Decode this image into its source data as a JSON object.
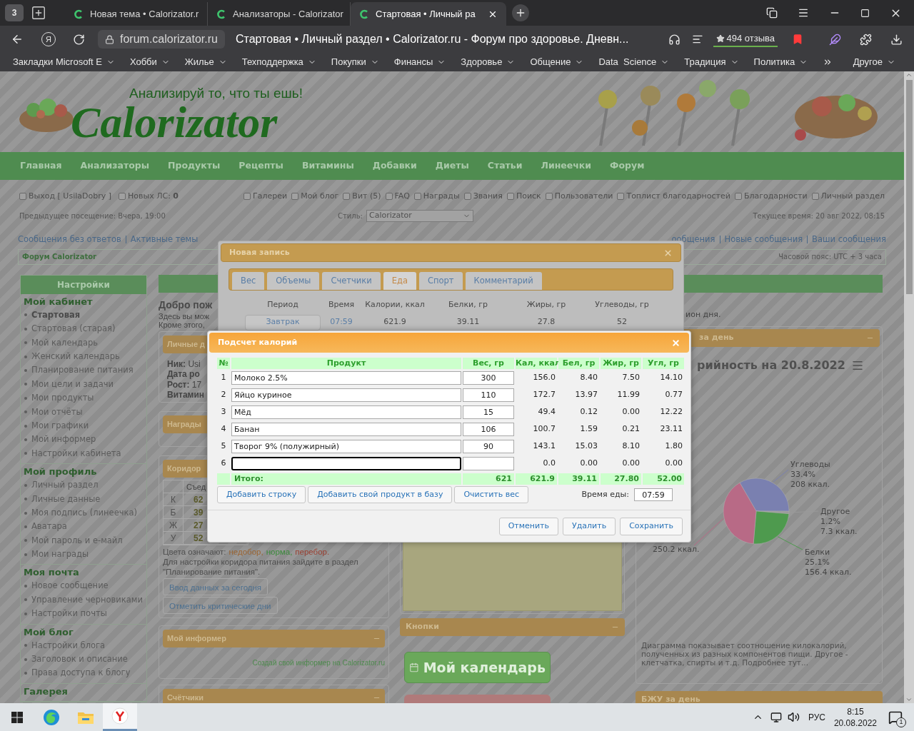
{
  "browser": {
    "tab_count": "3",
    "tabs": [
      {
        "title": "Новая тема • Calorizator.r",
        "selected": false
      },
      {
        "title": "Анализаторы - Calorizator",
        "selected": false
      },
      {
        "title": "Стартовая • Личный ра",
        "selected": true
      }
    ],
    "url": "forum.calorizator.ru",
    "yandex_button": "Я",
    "page_title": "Стартовая • Личный раздел • Calorizator.ru - Форум про здоровье. Дневн...",
    "reviews": "494 отзыва",
    "bookmarks": [
      "Закладки Microsoft E",
      "Хобби",
      "Жилье",
      "Техподдержка",
      "Покупки",
      "Финансы",
      "Здоровье",
      "Общение",
      "Data  Science",
      "Традиция",
      "Политика"
    ],
    "bookmarks_other": "Другое"
  },
  "site": {
    "slogan": "Анализируй то, что ты ешь!",
    "logo": "Calorizator",
    "nav": [
      "Главная",
      "Анализаторы",
      "Продукты",
      "Рецепты",
      "Витамины",
      "Добавки",
      "Диеты",
      "Статьи",
      "Линеечки",
      "Форум"
    ],
    "user_links_left": [
      "Выход [ UsilaDobry ]",
      "Новых ЛС: **0**"
    ],
    "user_links_right": [
      "Галереи",
      "Мой блог",
      "Вит (5)",
      "FAQ",
      "Награды",
      "Звания",
      "Поиск",
      "Пользователи",
      "Топлист благодарностей",
      "Благодарности",
      "Личный раздел"
    ],
    "last_visit": "Предыдущее посещение: Вчера, 19:00",
    "style_label": "Стиль:",
    "style_value": "Calorizator",
    "current_time": "Текущее время: 20 авг 2022, 08:15",
    "links_left": [
      "Сообщения без ответов",
      "Активные темы"
    ],
    "links_right": [
      "ообщения",
      "Новые сообщения",
      "Ваши сообщения"
    ],
    "forum_title": "Форум Calorizator",
    "timezone": "Часовой пояс: UTC + 3 часа"
  },
  "sidebar": {
    "title": "Настройки",
    "groups": [
      {
        "title": "Мой кабинет",
        "items": [
          {
            "label": "Стартовая",
            "selected": true
          },
          {
            "label": "Стартовая (старая)",
            "selected": false
          },
          {
            "label": "Мой календарь",
            "selected": false
          },
          {
            "label": "Женский календарь",
            "selected": false
          },
          {
            "label": "Планирование питания",
            "selected": false
          },
          {
            "label": "Мои цели и задачи",
            "selected": false
          },
          {
            "label": "Мои продукты",
            "selected": false
          },
          {
            "label": "Мои отчёты",
            "selected": false
          },
          {
            "label": "Мои графики",
            "selected": false
          },
          {
            "label": "Мой информер",
            "selected": false
          },
          {
            "label": "Настройки кабинета",
            "selected": false
          }
        ]
      },
      {
        "title": "Мой профиль",
        "items": [
          {
            "label": "Личный раздел",
            "selected": false
          },
          {
            "label": "Личные данные",
            "selected": false
          },
          {
            "label": "Моя подпись (линеечка)",
            "selected": false
          },
          {
            "label": "Аватара",
            "selected": false
          },
          {
            "label": "Мой пароль и е-майл",
            "selected": false
          },
          {
            "label": "Мои награды",
            "selected": false
          }
        ]
      },
      {
        "title": "Моя почта",
        "items": [
          {
            "label": "Новое сообщение",
            "selected": false
          },
          {
            "label": "Управление черновиками",
            "selected": false
          },
          {
            "label": "Настройки почты",
            "selected": false
          }
        ]
      },
      {
        "title": "Мой блог",
        "items": [
          {
            "label": "Настройки блога",
            "selected": false
          },
          {
            "label": "Заголовок и описание",
            "selected": false
          },
          {
            "label": "Права доступа к блогу",
            "selected": false
          }
        ]
      },
      {
        "title": "Галерея"
      }
    ]
  },
  "main": {
    "welcome_title": "Добро пож",
    "welcome_lines": [
      "Здесь вы мож",
      "Кроме этого,"
    ],
    "personal": {
      "title": "Личные д",
      "lines": [
        "**Ник:** Usi",
        "**Дата ро**",
        "**Рост:** 17",
        "**Витамин**"
      ]
    },
    "awards": {
      "title": "Награды"
    },
    "corridor": {
      "title": "Коридор",
      "column": "Съед",
      "rows": [
        {
          "label": "К",
          "value": "62"
        },
        {
          "label": "Б",
          "value": "39"
        },
        {
          "label": "Ж",
          "value": "27"
        },
        {
          "label": "У",
          "value": "52"
        }
      ],
      "legend_label": "Цвета означают:",
      "legend": [
        {
          "text": "недобор,",
          "color": "#9a6432"
        },
        {
          "text": "норма,",
          "color": "#3a8a3a"
        },
        {
          "text": "перебор.",
          "color": "#9a4032"
        }
      ],
      "note": "Для настройки коридора питания зайдите в раздел \"Планирование питания\".",
      "buttons": [
        "Ввод данных за сегодня",
        "Отметить критические дни"
      ]
    },
    "informer": {
      "title": "Мой информер",
      "link": "Создай свой информер на Calorizator.ru"
    },
    "counters": {
      "title": "Счётчики"
    }
  },
  "buttons_panel": {
    "title": "Кнопки",
    "calendar_button": "Мой календарь"
  },
  "diary": {
    "day_text": "ион дня.",
    "panel_title": "за день",
    "chart_title": "рийность на 20.8.2022",
    "chart_data": {
      "type": "pie",
      "values": [
        33.4,
        1.2,
        25.1,
        40.3
      ],
      "value_labels": [
        {
          "name": "Углеводы",
          "percent": "33.4%",
          "kcal": "208 ккал.",
          "color": "#7a80b0"
        },
        {
          "name": "Другое",
          "percent": "1.2%",
          "kcal": "7.3 ккал.",
          "color": "#9a9a9a"
        },
        {
          "name": "Белки",
          "percent": "25.1%",
          "kcal": "156.4 ккал.",
          "color": "#4e9a4e"
        },
        {
          "kcal": "250.2 ккал.",
          "color": "#b86a86"
        }
      ]
    },
    "description": "Диаграмма показывает соотношение килокалорий, полученных из разных компонентов пищи. Другое - клетчатка, спирты и т.д. Подробнее тут...",
    "bzhu_title": "БЖУ за день"
  },
  "new_entry": {
    "title": "Новая запись",
    "tabs": [
      {
        "label": "Вес",
        "selected": false
      },
      {
        "label": "Объемы",
        "selected": false
      },
      {
        "label": "Счетчики",
        "selected": false
      },
      {
        "label": "Еда",
        "selected": true
      },
      {
        "label": "Спорт",
        "selected": false
      },
      {
        "label": "Комментарий",
        "selected": false
      }
    ],
    "columns": [
      "Период",
      "Время",
      "Калории, ккал",
      "Белки, гр",
      "Жиры, гр",
      "Углеводы, гр"
    ],
    "row": {
      "period": "Завтрак",
      "time": "07:59",
      "values": [
        "621.9",
        "39.11",
        "27.8",
        "52"
      ]
    }
  },
  "calorie_counter": {
    "title": "Подсчет калорий",
    "columns": [
      "№",
      "Продукт",
      "Вес, гр",
      "Кал, ккал",
      "Бел, гр",
      "Жир, гр",
      "Угл, гр"
    ],
    "rows": [
      {
        "n": "1",
        "product": "Молоко 2.5%",
        "weight": "300",
        "values": [
          "156.0",
          "8.40",
          "7.50",
          "14.10"
        ],
        "focused": false
      },
      {
        "n": "2",
        "product": "Яйцо куриное",
        "weight": "110",
        "values": [
          "172.7",
          "13.97",
          "11.99",
          "0.77"
        ],
        "focused": false
      },
      {
        "n": "3",
        "product": "Мёд",
        "weight": "15",
        "values": [
          "49.4",
          "0.12",
          "0.00",
          "12.22"
        ],
        "focused": false
      },
      {
        "n": "4",
        "product": "Банан",
        "weight": "106",
        "values": [
          "100.7",
          "1.59",
          "0.21",
          "23.11"
        ],
        "focused": false
      },
      {
        "n": "5",
        "product": "Творог 9% (полужирный)",
        "weight": "90",
        "values": [
          "143.1",
          "15.03",
          "8.10",
          "1.80"
        ],
        "focused": false
      },
      {
        "n": "6",
        "values": [
          "0.0",
          "0.00",
          "0.00",
          "0.00"
        ],
        "focused": true
      }
    ],
    "total": {
      "label": "Итого:",
      "weight": "621",
      "values": [
        "621.9",
        "39.11",
        "27.80",
        "52.00"
      ]
    },
    "actions": [
      "Добавить строку",
      "Добавить свой продукт в базу",
      "Очистить вес"
    ],
    "meal_time_label": "Время еды:",
    "meal_time": "07:59",
    "footer_buttons": [
      "Отменить",
      "Удалить",
      "Сохранить"
    ]
  },
  "taskbar": {
    "apps": [
      {
        "kind": "edge",
        "active": false
      },
      {
        "kind": "explorer",
        "active": false
      },
      {
        "kind": "yandex",
        "active": true
      }
    ],
    "language": "РУС",
    "time": "8:15",
    "date": "20.08.2022",
    "notifications": "1"
  }
}
